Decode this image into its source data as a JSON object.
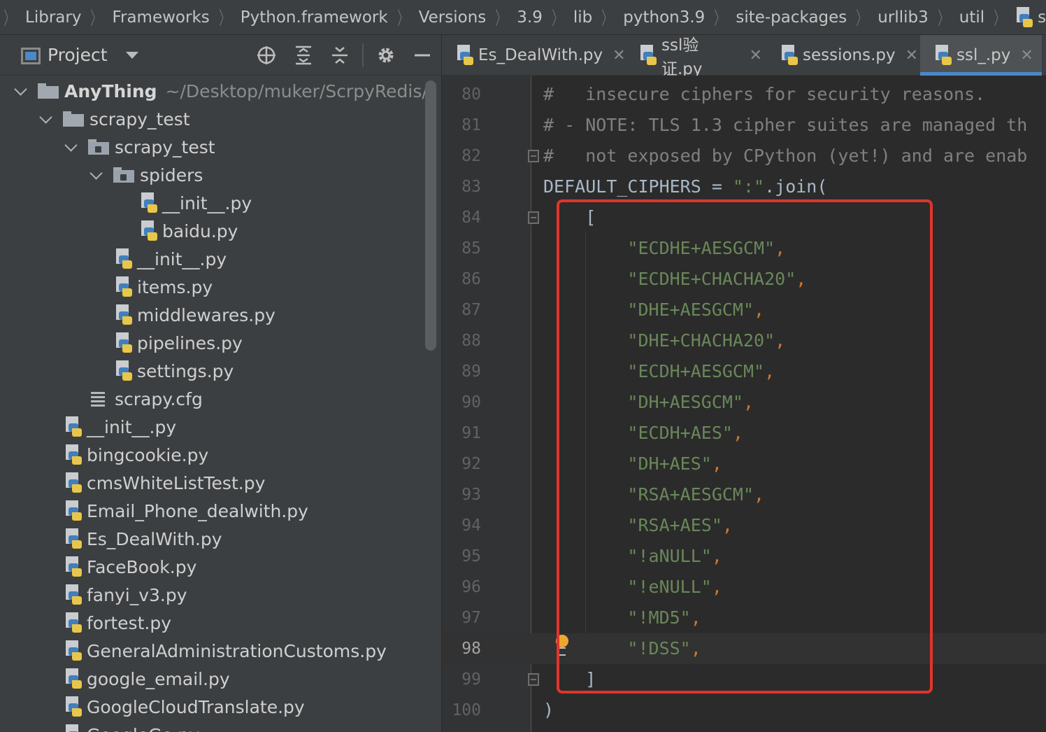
{
  "breadcrumb": {
    "items": [
      "Library",
      "Frameworks",
      "Python.framework",
      "Versions",
      "3.9",
      "lib",
      "python3.9",
      "site-packages",
      "urllib3",
      "util",
      "ssl_.py"
    ]
  },
  "project_panel": {
    "title": "Project",
    "header_icons": [
      "crosshair-icon",
      "expand-all-icon",
      "collapse-all-icon",
      "gear-icon",
      "minimize-icon"
    ],
    "tree": [
      {
        "label": "AnyThing",
        "path": "~/Desktop/muker/ScrpyRedis/A",
        "type": "root-folder",
        "depth": 0,
        "expanded": true
      },
      {
        "label": "scrapy_test",
        "type": "folder",
        "depth": 1,
        "expanded": true
      },
      {
        "label": "scrapy_test",
        "type": "package",
        "depth": 2,
        "expanded": true
      },
      {
        "label": "spiders",
        "type": "package",
        "depth": 3,
        "expanded": true
      },
      {
        "label": "__init__.py",
        "type": "python-file",
        "depth": 4
      },
      {
        "label": "baidu.py",
        "type": "python-file",
        "depth": 4
      },
      {
        "label": "__init__.py",
        "type": "python-file",
        "depth": 3
      },
      {
        "label": "items.py",
        "type": "python-file",
        "depth": 3
      },
      {
        "label": "middlewares.py",
        "type": "python-file",
        "depth": 3
      },
      {
        "label": "pipelines.py",
        "type": "python-file",
        "depth": 3
      },
      {
        "label": "settings.py",
        "type": "python-file",
        "depth": 3
      },
      {
        "label": "scrapy.cfg",
        "type": "config-file",
        "depth": 2
      },
      {
        "label": "__init__.py",
        "type": "python-file",
        "depth": 1
      },
      {
        "label": "bingcookie.py",
        "type": "python-file",
        "depth": 1
      },
      {
        "label": "cmsWhiteListTest.py",
        "type": "python-file",
        "depth": 1
      },
      {
        "label": "Email_Phone_dealwith.py",
        "type": "python-file",
        "depth": 1
      },
      {
        "label": "Es_DealWith.py",
        "type": "python-file",
        "depth": 1
      },
      {
        "label": "FaceBook.py",
        "type": "python-file",
        "depth": 1
      },
      {
        "label": "fanyi_v3.py",
        "type": "python-file",
        "depth": 1
      },
      {
        "label": "fortest.py",
        "type": "python-file",
        "depth": 1
      },
      {
        "label": "GeneralAdministrationCustoms.py",
        "type": "python-file",
        "depth": 1
      },
      {
        "label": "google_email.py",
        "type": "python-file",
        "depth": 1
      },
      {
        "label": "GoogleCloudTranslate.py",
        "type": "python-file",
        "depth": 1
      },
      {
        "label": "GoogleGo.py",
        "type": "python-file",
        "depth": 1
      }
    ]
  },
  "tabs": [
    {
      "label": "Es_DealWith.py",
      "active": false
    },
    {
      "label": "ssl验证.py",
      "active": false
    },
    {
      "label": "sessions.py",
      "active": false
    },
    {
      "label": "ssl_.py",
      "active": true
    }
  ],
  "tab_close_glyph": "✕",
  "editor": {
    "current_line": 98,
    "lines": [
      {
        "n": 80,
        "text": "#   insecure ciphers for security reasons.",
        "kind": "comment"
      },
      {
        "n": 81,
        "text": "# - NOTE: TLS 1.3 cipher suites are managed th",
        "kind": "comment"
      },
      {
        "n": 82,
        "text": "#   not exposed by CPython (yet!) and are enab",
        "kind": "comment"
      },
      {
        "n": 83,
        "text": "DEFAULT_CIPHERS = \":\".join(",
        "kind": "assign"
      },
      {
        "n": 84,
        "text": "    [",
        "kind": "plain"
      },
      {
        "n": 85,
        "text": "\"ECDHE+AESGCM\"",
        "kind": "string"
      },
      {
        "n": 86,
        "text": "\"ECDHE+CHACHA20\"",
        "kind": "string"
      },
      {
        "n": 87,
        "text": "\"DHE+AESGCM\"",
        "kind": "string"
      },
      {
        "n": 88,
        "text": "\"DHE+CHACHA20\"",
        "kind": "string"
      },
      {
        "n": 89,
        "text": "\"ECDH+AESGCM\"",
        "kind": "string"
      },
      {
        "n": 90,
        "text": "\"DH+AESGCM\"",
        "kind": "string"
      },
      {
        "n": 91,
        "text": "\"ECDH+AES\"",
        "kind": "string"
      },
      {
        "n": 92,
        "text": "\"DH+AES\"",
        "kind": "string"
      },
      {
        "n": 93,
        "text": "\"RSA+AESGCM\"",
        "kind": "string"
      },
      {
        "n": 94,
        "text": "\"RSA+AES\"",
        "kind": "string"
      },
      {
        "n": 95,
        "text": "\"!aNULL\"",
        "kind": "string"
      },
      {
        "n": 96,
        "text": "\"!eNULL\"",
        "kind": "string"
      },
      {
        "n": 97,
        "text": "\"!MD5\"",
        "kind": "string"
      },
      {
        "n": 98,
        "text": "\"!DSS\"",
        "kind": "string"
      },
      {
        "n": 99,
        "text": "    ]",
        "kind": "plain"
      },
      {
        "n": 100,
        "text": ")",
        "kind": "plain"
      }
    ]
  },
  "colors": {
    "accent": "#4a88c7",
    "highlight_box": "#e0352b",
    "string": "#6a8759",
    "comment": "#808080",
    "keyword_op": "#cc7832",
    "text": "#a9b7c6"
  }
}
